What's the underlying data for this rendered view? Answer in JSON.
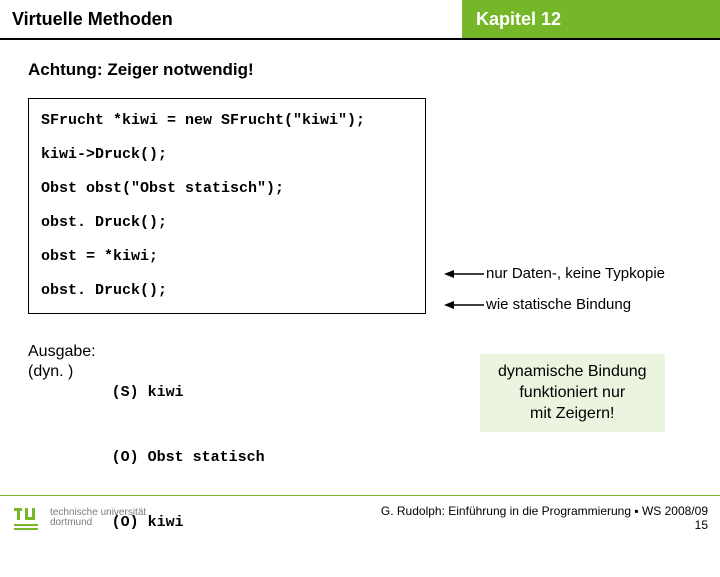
{
  "header": {
    "title": "Virtuelle Methoden",
    "chapter": "Kapitel 12"
  },
  "warning": "Achtung: Zeiger notwendig!",
  "code": {
    "l1": "SFrucht *kiwi = new SFrucht(\"kiwi\");",
    "l2": "kiwi->Druck();",
    "l3": "Obst obst(\"Obst statisch\");",
    "l4": "obst. Druck();",
    "l5": "obst = *kiwi;",
    "l6": "obst. Druck();"
  },
  "annotations": {
    "a1": "nur Daten-, keine Typkopie",
    "a2": "wie statische Bindung"
  },
  "output": {
    "label_l1": "Ausgabe:",
    "label_l2": "(dyn. )",
    "o1": "(S) kiwi",
    "o2": "(O) Obst statisch",
    "o3": "(O) kiwi"
  },
  "highlight": {
    "l1": "dynamische Bindung",
    "l2": "funktioniert nur",
    "l3": "mit Zeigern!"
  },
  "footer": {
    "uni_l1": "technische universität",
    "uni_l2": "dortmund",
    "credit": "G. Rudolph: Einführung in die Programmierung ▪ WS 2008/09",
    "slide": "15"
  }
}
